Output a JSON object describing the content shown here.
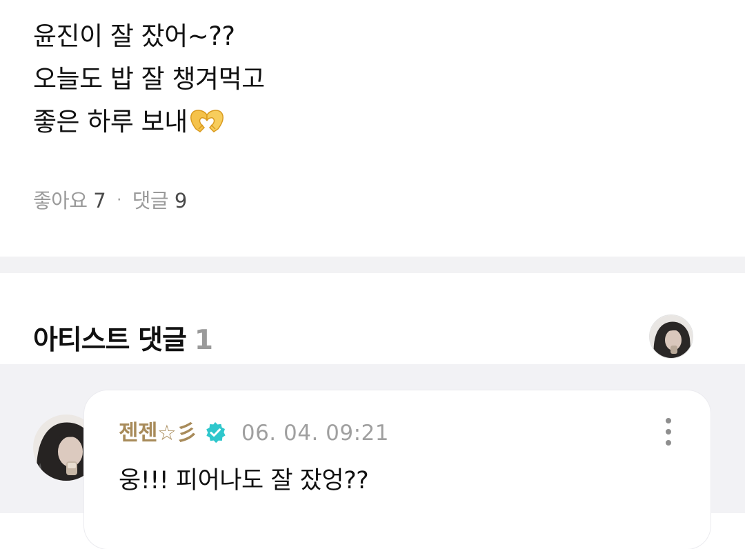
{
  "post": {
    "lines": [
      "윤진이 잘 잤어~??",
      "오늘도 밥 잘 챙겨먹고",
      "좋은 하루 보내"
    ],
    "emoji": "heart-hands-emoji",
    "likes_label": "좋아요",
    "likes_count": "7",
    "separator": "·",
    "comments_label": "댓글",
    "comments_count": "9"
  },
  "artist_comments": {
    "title": "아티스트 댓글",
    "count": "1",
    "header_avatar_icon": "artist-avatar"
  },
  "comment": {
    "author": "젠젠☆彡",
    "verified_icon": "verified-badge-icon",
    "timestamp": "06. 04. 09:21",
    "text": "웅!!! 피어나도 잘 잤엉??",
    "more_icon": "more-vertical-icon"
  },
  "colors": {
    "author": "#a88b5a",
    "verified": "#2fc7cc",
    "muted_text": "#9a9a9a",
    "section_bg": "#f2f2f5"
  }
}
